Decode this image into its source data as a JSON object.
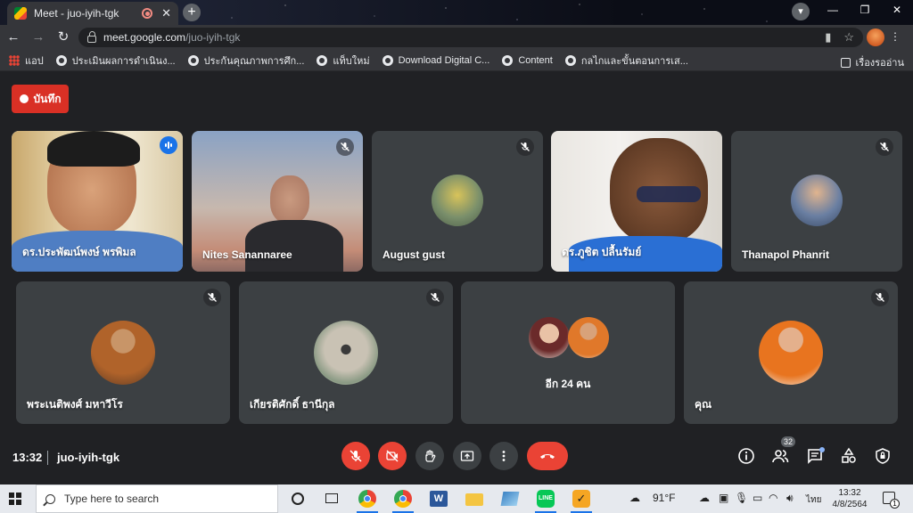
{
  "browser": {
    "tab_title": "Meet - juo-iyih-tgk",
    "tab_close": "✕",
    "new_tab": "+",
    "url_host": "meet.google.com",
    "url_path": "/juo-iyih-tgk",
    "window_minimize": "—",
    "window_maximize": "❐",
    "window_close": "✕"
  },
  "bookmarks": {
    "items": [
      {
        "label": "แอป",
        "icon": "apps-grid-icon"
      },
      {
        "label": "ประเมินผลการดำเนินง...",
        "icon": "globe-icon"
      },
      {
        "label": "ประกันคุณภาพการศึก...",
        "icon": "globe-icon"
      },
      {
        "label": "แท็บใหม่",
        "icon": "globe-icon"
      },
      {
        "label": "Download Digital C...",
        "icon": "globe-icon"
      },
      {
        "label": "Content",
        "icon": "globe-icon"
      },
      {
        "label": "กลไกและขั้นตอนการเส...",
        "icon": "globe-icon"
      }
    ],
    "reading_list": "เรื่องรออ่าน"
  },
  "meet": {
    "record_label": "บันทึก",
    "participants": [
      {
        "name": "ดร.ประพัฒน์พงษ์ พรพิมล",
        "speaking": true
      },
      {
        "name": "Nites Sanannaree",
        "muted": true
      },
      {
        "name": "August gust",
        "muted": true
      },
      {
        "name": "ดร.ภูชิต ปลื้นรัมย์"
      },
      {
        "name": "Thanapol Phanrit",
        "muted": true
      },
      {
        "name": "พระเนติพงศ์ มหาวีโร",
        "muted": true
      },
      {
        "name": "เกียรติศักดิ์ ธานีกุล",
        "muted": true
      },
      {
        "name": "อีก 24 คน"
      },
      {
        "name": "คุณ",
        "muted": true
      }
    ],
    "time": "13:32",
    "meeting_code": "juo-iyih-tgk",
    "people_count": "32",
    "colors": {
      "accent": "#8ab4f8",
      "danger": "#ea4335",
      "tile": "#3c4043",
      "background": "#202124"
    }
  },
  "taskbar": {
    "search_placeholder": "Type here to search",
    "temperature": "91°F",
    "language": "ไทย",
    "clock_time": "13:32",
    "clock_date": "4/8/2564",
    "notifications": "1"
  }
}
